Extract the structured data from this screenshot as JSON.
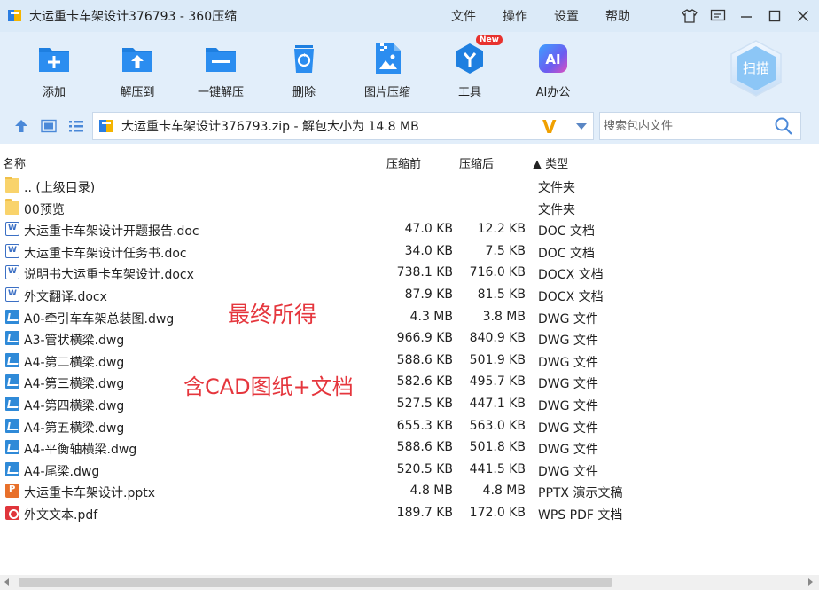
{
  "window": {
    "title": "大运重卡车架设计376793 - 360压缩",
    "menus": [
      "文件",
      "操作",
      "设置",
      "帮助"
    ]
  },
  "toolbar": {
    "add": "添加",
    "extract_to": "解压到",
    "one_click_extract": "一键解压",
    "delete": "删除",
    "image_compress": "图片压缩",
    "tools": "工具",
    "tools_badge": "New",
    "ai_office": "AI办公",
    "ai_icon_text": "AI",
    "scan": "扫描"
  },
  "addressbar": {
    "path": "大运重卡车架设计376793.zip - 解包大小为 14.8 MB",
    "badge": "V",
    "search_placeholder": "搜索包内文件"
  },
  "columns": {
    "name": "名称",
    "packed": "压缩前",
    "unpacked": "压缩后",
    "type": "▲ 类型"
  },
  "files": [
    {
      "name": ".. (上级目录)",
      "packed": "",
      "unpacked": "",
      "type": "文件夹",
      "icon": "folder"
    },
    {
      "name": "00预览",
      "packed": "",
      "unpacked": "",
      "type": "文件夹",
      "icon": "folder"
    },
    {
      "name": "大运重卡车架设计开题报告.doc",
      "packed": "47.0 KB",
      "unpacked": "12.2 KB",
      "type": "DOC 文档",
      "icon": "doc"
    },
    {
      "name": "大运重卡车架设计任务书.doc",
      "packed": "34.0 KB",
      "unpacked": "7.5 KB",
      "type": "DOC 文档",
      "icon": "doc"
    },
    {
      "name": "说明书大运重卡车架设计.docx",
      "packed": "738.1 KB",
      "unpacked": "716.0 KB",
      "type": "DOCX 文档",
      "icon": "doc"
    },
    {
      "name": "外文翻译.docx",
      "packed": "87.9 KB",
      "unpacked": "81.5 KB",
      "type": "DOCX 文档",
      "icon": "doc"
    },
    {
      "name": "A0-牵引车车架总装图.dwg",
      "packed": "4.3 MB",
      "unpacked": "3.8 MB",
      "type": "DWG 文件",
      "icon": "dwg"
    },
    {
      "name": "A3-管状横梁.dwg",
      "packed": "966.9 KB",
      "unpacked": "840.9 KB",
      "type": "DWG 文件",
      "icon": "dwg"
    },
    {
      "name": "A4-第二横梁.dwg",
      "packed": "588.6 KB",
      "unpacked": "501.9 KB",
      "type": "DWG 文件",
      "icon": "dwg"
    },
    {
      "name": "A4-第三横梁.dwg",
      "packed": "582.6 KB",
      "unpacked": "495.7 KB",
      "type": "DWG 文件",
      "icon": "dwg"
    },
    {
      "name": "A4-第四横梁.dwg",
      "packed": "527.5 KB",
      "unpacked": "447.1 KB",
      "type": "DWG 文件",
      "icon": "dwg"
    },
    {
      "name": "A4-第五横梁.dwg",
      "packed": "655.3 KB",
      "unpacked": "563.0 KB",
      "type": "DWG 文件",
      "icon": "dwg"
    },
    {
      "name": "A4-平衡轴横梁.dwg",
      "packed": "588.6 KB",
      "unpacked": "501.8 KB",
      "type": "DWG 文件",
      "icon": "dwg"
    },
    {
      "name": "A4-尾梁.dwg",
      "packed": "520.5 KB",
      "unpacked": "441.5 KB",
      "type": "DWG 文件",
      "icon": "dwg"
    },
    {
      "name": "大运重卡车架设计.pptx",
      "packed": "4.8 MB",
      "unpacked": "4.8 MB",
      "type": "PPTX 演示文稿",
      "icon": "ppt"
    },
    {
      "name": "外文文本.pdf",
      "packed": "189.7 KB",
      "unpacked": "172.0 KB",
      "type": "WPS PDF 文档",
      "icon": "pdf"
    }
  ],
  "annotations": {
    "line1": "最终所得",
    "line2": "含CAD图纸+文档"
  },
  "colors": {
    "accent": "#2a7de1",
    "toolbar_bg": "#e2eefa",
    "annotation": "#e5363d"
  }
}
